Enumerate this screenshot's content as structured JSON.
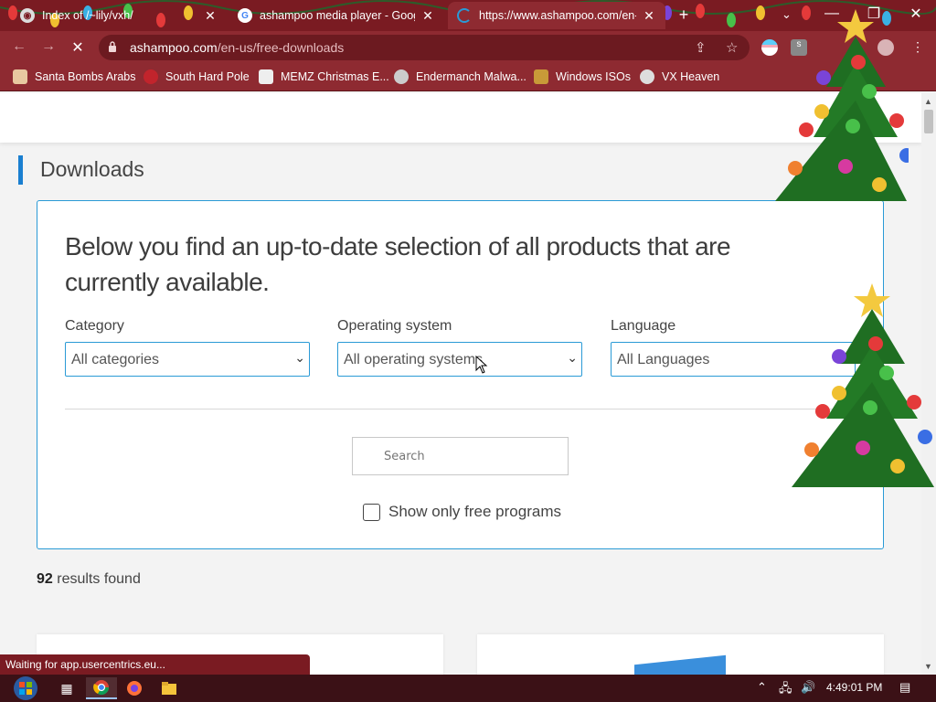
{
  "tabs": [
    {
      "title": "Index of /~lily/vxh/",
      "active": false
    },
    {
      "title": "ashampoo media player - Googl",
      "active": false
    },
    {
      "title": "https://www.ashampoo.com/en-",
      "active": true
    }
  ],
  "address_bar": {
    "domain": "ashampoo.com",
    "path": "/en-us/free-downloads"
  },
  "bookmarks": [
    {
      "label": "Santa Bombs Arabs",
      "icon": "candle-icon"
    },
    {
      "label": "South Hard Pole",
      "icon": "virus-icon"
    },
    {
      "label": "MEMZ Christmas E...",
      "icon": "memz-icon"
    },
    {
      "label": "Endermanch Malwa...",
      "icon": "endermanch-icon"
    },
    {
      "label": "Windows ISOs",
      "icon": "windows-iso-icon"
    },
    {
      "label": "VX Heaven",
      "icon": "vx-heaven-icon"
    }
  ],
  "page": {
    "heading": "Downloads",
    "intro": "Below you find an up-to-date selection of all products that are currently available.",
    "filters": [
      {
        "label": "Category",
        "value": "All categories"
      },
      {
        "label": "Operating system",
        "value": "All operating systems"
      },
      {
        "label": "Language",
        "value": "All Languages"
      }
    ],
    "search_placeholder": "Search",
    "free_only_label": "Show only free programs",
    "results_count": "92",
    "results_suffix": " results found"
  },
  "status_text": "Waiting for app.usercentrics.eu...",
  "taskbar": {
    "clock": "4:49:01 PM"
  },
  "colors": {
    "chrome": "#8e2a31",
    "tabstrip": "#7a1b22",
    "accent": "#2a9ad6",
    "taskbar": "#3b1116"
  }
}
